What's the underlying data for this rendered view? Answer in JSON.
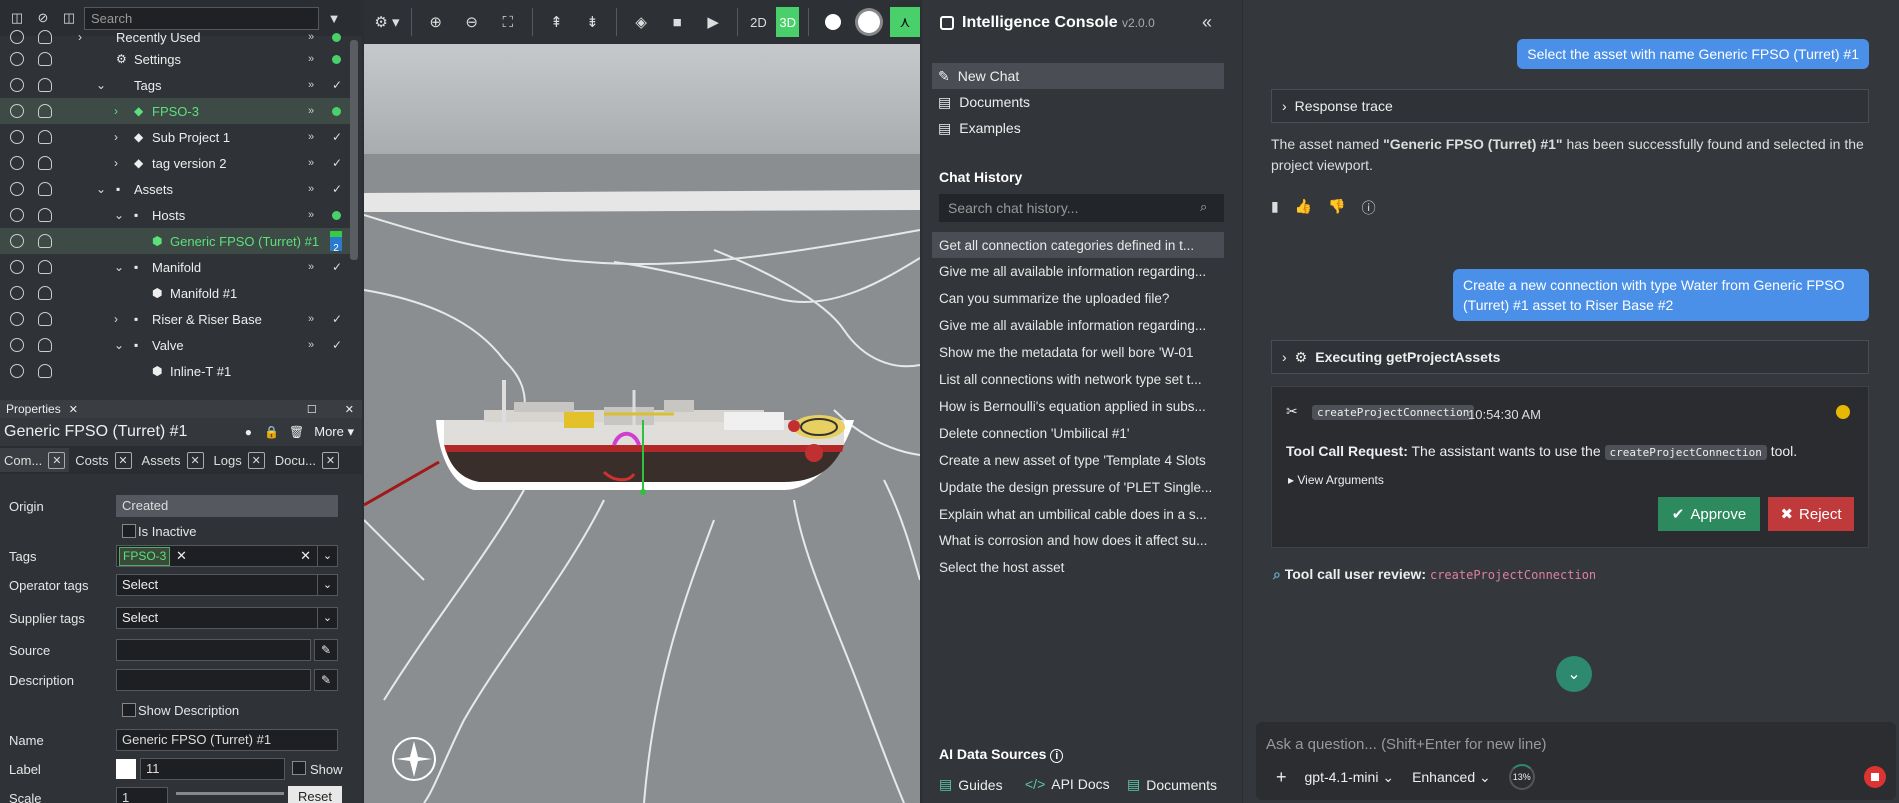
{
  "tree": {
    "search_placeholder": "Search",
    "rows": [
      {
        "label": "Recently Used",
        "status": "dot"
      },
      {
        "label": "Settings",
        "status": "dot"
      },
      {
        "label": "Tags",
        "status": "check"
      },
      {
        "label": "FPSO-3",
        "status": "dot",
        "selected": true
      },
      {
        "label": "Sub Project 1",
        "status": "check"
      },
      {
        "label": "tag version 2",
        "status": "check"
      },
      {
        "label": "Assets",
        "status": "check"
      },
      {
        "label": "Hosts",
        "status": "dot"
      },
      {
        "label": "Generic FPSO (Turret) #1",
        "status": "badge",
        "selected": true
      },
      {
        "label": "Manifold",
        "status": "check"
      },
      {
        "label": "Manifold #1",
        "status": "none"
      },
      {
        "label": "Riser & Riser Base",
        "status": "check"
      },
      {
        "label": "Valve",
        "status": "check"
      },
      {
        "label": "Inline-T #1",
        "status": "none"
      }
    ],
    "badge_count": "2"
  },
  "properties": {
    "header": "Properties",
    "title": "Generic FPSO (Turret) #1",
    "more_label": "More",
    "tabs": [
      "Com...",
      "Costs",
      "Assets",
      "Logs",
      "Docu..."
    ],
    "origin_label": "Origin",
    "origin_value": "Created",
    "inactive_label": "Is Inactive",
    "tags_label": "Tags",
    "tag_chip": "FPSO-3",
    "operator_label": "Operator tags",
    "operator_value": "Select",
    "supplier_label": "Supplier tags",
    "supplier_value": "Select",
    "source_label": "Source",
    "description_label": "Description",
    "show_description_label": "Show Description",
    "name_label": "Name",
    "name_value": "Generic FPSO (Turret) #1",
    "label_label": "Label",
    "label_value": "11",
    "show_label": "Show",
    "scale_label": "Scale",
    "scale_value": "1",
    "reset_label": "Reset"
  },
  "viewport": {
    "btn_2d": "2D",
    "btn_3d": "3D"
  },
  "sidebar": {
    "title": "Intelligence Console",
    "version": "v2.0.0",
    "nav": [
      "New Chat",
      "Documents",
      "Examples"
    ],
    "history_label": "Chat History",
    "search_placeholder": "Search chat history...",
    "history": [
      "Get all connection categories defined in t...",
      "Give me all available information regarding...",
      "Can you summarize the uploaded file?",
      "Give me all available information regarding...",
      "Show me the metadata for well bore 'W-01",
      "List all connections with network type set t...",
      "How is Bernoulli's equation applied in subs...",
      "Delete connection 'Umbilical #1'",
      "Create a new asset of type 'Template 4 Slots",
      "Update the design pressure of 'PLET Single...",
      "Explain what an umbilical cable does in a s...",
      "What is corrosion and how does it affect su...",
      "Select the host asset"
    ],
    "ai_sources_label": "AI Data Sources",
    "links": [
      "Guides",
      "API Docs",
      "Documents"
    ]
  },
  "chat": {
    "user_msg_1": "Select the asset with name Generic FPSO (Turret) #1",
    "trace_label": "Response trace",
    "reply_pre": "The asset named ",
    "reply_bold": "\"Generic FPSO (Turret) #1\"",
    "reply_post": " has been successfully found and selected in the project viewport.",
    "user_msg_2": "Create a new connection with type Water from Generic FPSO (Turret) #1 asset to Riser Base #2",
    "executing_label": "Executing getProjectAssets",
    "tool_name": "createProjectConnection",
    "tool_time": "10:54:30 AM",
    "request_bold": "Tool Call Request:",
    "request_text": " The assistant wants to use the ",
    "request_tail": " tool.",
    "view_args": "View Arguments",
    "approve": "Approve",
    "reject": "Reject",
    "review_label": "Tool call user review:",
    "review_tool": "createProjectConnection",
    "composer_placeholder": "Ask a question... (Shift+Enter for new line)",
    "model": "gpt-4.1-mini",
    "mode": "Enhanced",
    "usage": "13%"
  }
}
